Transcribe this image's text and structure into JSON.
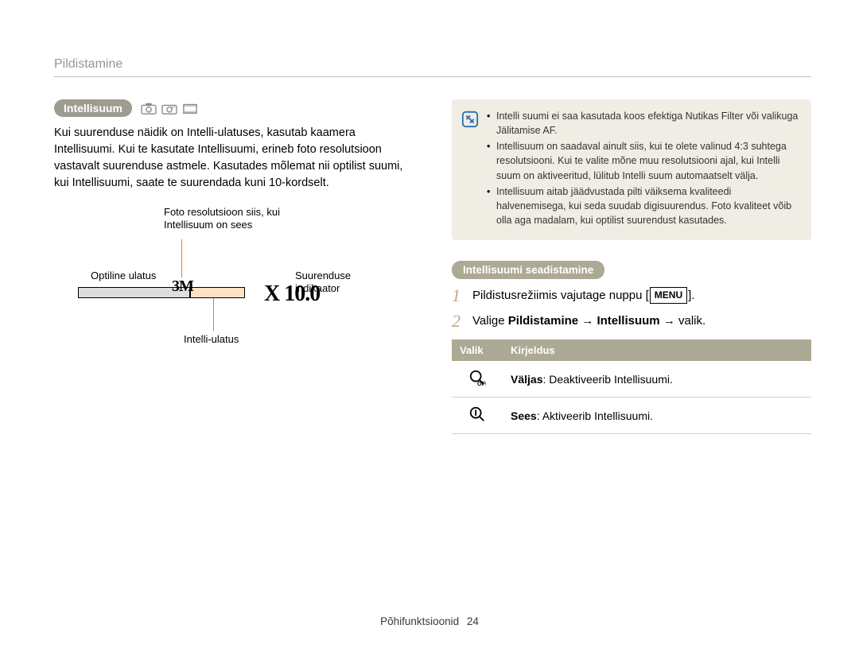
{
  "header": {
    "title": "Pildistamine"
  },
  "left": {
    "heading": "Intellisuum",
    "intro": "Kui suurenduse näidik on Intelli-ulatuses, kasutab kaamera Intellisuumi. Kui te kasutate Intellisuumi, erineb foto resolutsioon vastavalt suurenduse astmele. Kasutades mõlemat nii optilist suumi, kui Intellisuumi, saate te suurendada kuni 10-kordselt.",
    "diagram": {
      "resolution_label": "Foto resolutsioon siis, kui Intellisuum on sees",
      "optical_label": "Optiline ulatus",
      "indicator_label": "Suurenduse indikaator",
      "intelli_label": "Intelli-ulatus",
      "res_value": "3M",
      "zoom_value": "X 10.0"
    }
  },
  "right": {
    "notes": [
      "Intelli suumi ei saa kasutada koos efektiga Nutikas Filter või valikuga Jälitamise AF.",
      "Intellisuum on saadaval ainult siis, kui te olete valinud 4:3 suhtega resolutsiooni. Kui te valite mõne muu resolutsiooni ajal, kui Intelli suum on aktiveeritud, lülitub Intelli suum automaatselt välja.",
      "Intellisuum aitab jäädvustada pilti väiksema kvaliteedi halvenemisega, kui seda suudab digisuurendus. Foto kvaliteet võib olla aga madalam, kui optilist suurendust kasutades."
    ],
    "subheading": "Intellisuumi seadistamine",
    "step1_pre": "Pildistusrežiimis vajutage nuppu [",
    "step1_menu": "MENU",
    "step1_post": "].",
    "step2_pre": "Valige ",
    "step2_b1": "Pildistamine",
    "step2_arrow1": " → ",
    "step2_b2": "Intellisuum",
    "step2_arrow2": " → ",
    "step2_post": "valik.",
    "table": {
      "head_option": "Valik",
      "head_desc": "Kirjeldus",
      "off_label": "Väljas",
      "off_desc": ": Deaktiveerib Intellisuumi.",
      "on_label": "Sees",
      "on_desc": ": Aktiveerib Intellisuumi."
    }
  },
  "footer": {
    "section": "Põhifunktsioonid",
    "page": "24"
  }
}
